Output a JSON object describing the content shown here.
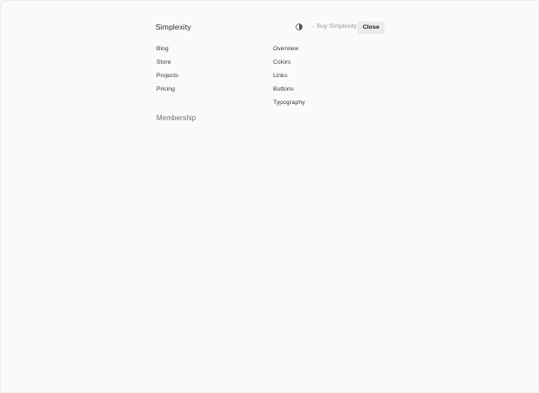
{
  "header": {
    "site_title": "Simplexity",
    "theme_toggle_icon": "contrast-circle-icon",
    "buy_link_label": "→ Buy Simplexity",
    "close_label": "Close"
  },
  "menu": {
    "left_items": [
      "Blog",
      "Store",
      "Projects",
      "Pricing"
    ],
    "right_items": [
      "Overview",
      "Colors",
      "Links",
      "Buttons",
      "Typography"
    ],
    "section_heading": "Membership"
  },
  "colors": {
    "background": "#fafafa",
    "close_button_bg": "#ebebeb",
    "muted_text": "#9a9a9a"
  }
}
